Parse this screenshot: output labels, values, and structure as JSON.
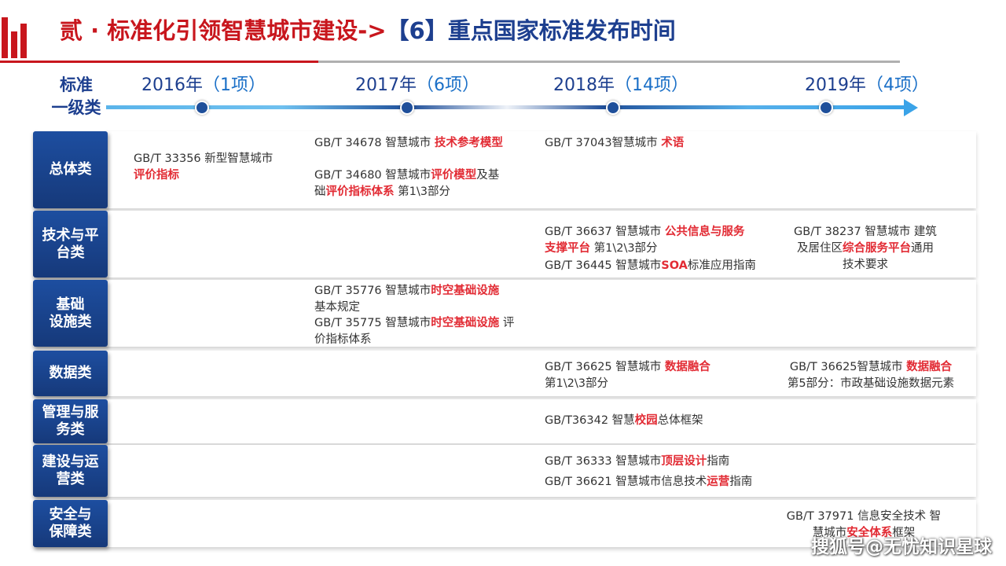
{
  "header": {
    "title_prefix": "贰 · 标准化引领智慧城市建设->",
    "title_suffix": "【6】重点国家标准发布时间"
  },
  "timeline": {
    "corner_label_1": "标准",
    "corner_label_2": "一级类",
    "years": [
      {
        "year": "2016年",
        "paren_open": "（",
        "count": "1项",
        "paren_close": "）"
      },
      {
        "year": "2017年",
        "paren_open": "（",
        "count": "6项",
        "paren_close": "）"
      },
      {
        "year": "2018年",
        "paren_open": "（",
        "count": "14项",
        "paren_close": "）"
      },
      {
        "year": "2019年",
        "paren_open": "（",
        "count": "4项",
        "paren_close": "）"
      }
    ]
  },
  "categories": [
    {
      "label_1": "总体类",
      "label_2": ""
    },
    {
      "label_1": "技术与平",
      "label_2": "台类"
    },
    {
      "label_1": "基础",
      "label_2": "设施类"
    },
    {
      "label_1": "数据类",
      "label_2": ""
    },
    {
      "label_1": "管理与服",
      "label_2": "务类"
    },
    {
      "label_1": "建设与运",
      "label_2": "营类"
    },
    {
      "label_1": "安全与",
      "label_2": "保障类"
    }
  ],
  "entries": {
    "e1": {
      "a": "GB/T 33356  新型智慧城市",
      "b": "评价指标"
    },
    "e2": {
      "a": "GB/T 34678   智慧城市 ",
      "b": "技术参考模型"
    },
    "e3": {
      "a": "GB/T 34680   智慧城市",
      "b": "评价模型",
      "c": "及基",
      "d": "础",
      "e": "评价指标体系",
      "f": " 第1\\3部分"
    },
    "e4": {
      "a": "GB/T 37043智慧城市 ",
      "b": "术语"
    },
    "e5": {
      "a": "GB/T 36637 智慧城市 ",
      "b": "公共信息与服务",
      "c": "支撑平台",
      "d": " 第1\\2\\3部分"
    },
    "e6": {
      "a": "GB/T 36445 智慧城市",
      "b": "SOA",
      "c": "标准应用指南"
    },
    "e7": {
      "a": "GB/T 38237 智慧城市 建筑",
      "b": "及居住区",
      "c": "综合服务平台",
      "d": "通用",
      "e": "技术要求"
    },
    "e8": {
      "a": "GB/T 35776   智慧城市",
      "b": "时空基础设施",
      "c": "基本规定"
    },
    "e9": {
      "a": "GB/T 35775  智慧城市",
      "b": "时空基础设施",
      "c": " 评",
      "d": "价指标体系"
    },
    "e10": {
      "a": "GB/T 36625 智慧城市 ",
      "b": "数据融合",
      "c": "第1\\2\\3部分"
    },
    "e11": {
      "a": "GB/T 36625智慧城市 ",
      "b": "数据融合",
      "c": "第5部分：市政基础设施数据元素"
    },
    "e12": {
      "a": "GB/T36342 智慧",
      "b": "校园",
      "c": "总体框架"
    },
    "e13": {
      "a": "GB/T 36333 智慧城市",
      "b": "顶层设计",
      "c": "指南"
    },
    "e14": {
      "a": "GB/T 36621 智慧城市信息技术",
      "b": "运营",
      "c": "指南"
    },
    "e15": {
      "a": "GB/T 37971 信息安全技术 智",
      "b": "慧城市",
      "c": "安全体系",
      "d": "框架"
    }
  },
  "watermark": "搜狐号@无忧知识星球",
  "colors": {
    "accent_red": "#c8161d",
    "highlight_red": "#e22b34",
    "navy": "#1d3f8f",
    "timeline_blue": "#3aa3e8"
  }
}
